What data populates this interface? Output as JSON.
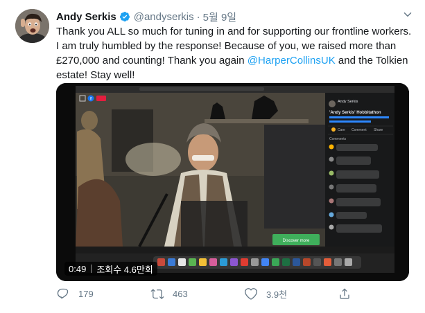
{
  "tweet": {
    "author_name": "Andy Serkis",
    "handle": "@andyserkis",
    "separator": "·",
    "date": "5월 9일",
    "text_parts": {
      "t1": "Thank you ALL so much for tuning in and for supporting our frontline workers. I am truly humbled by the response!  Because of you, we raised more than £270,000 and counting!  Thank you again ",
      "mention": "@HarperCollinsUK",
      "t2": " and the Tolkien estate!  Stay well!"
    }
  },
  "video": {
    "duration": "0:49",
    "views": "조회수 4.6만회",
    "facebook_panel": {
      "page_name": "Andy Serkis",
      "post_title": "'Andy Serkis' Hobbitathon",
      "actions": [
        "Care",
        "Comment",
        "Share"
      ],
      "comments_label": "Comments"
    },
    "green_button": "Discover more"
  },
  "actions": {
    "replies": "179",
    "retweets": "463",
    "likes": "3.9천"
  },
  "colors": {
    "link": "#1da1f2",
    "secondary": "#657786",
    "verified": "#1da1f2",
    "facebook": "#1877f2"
  }
}
